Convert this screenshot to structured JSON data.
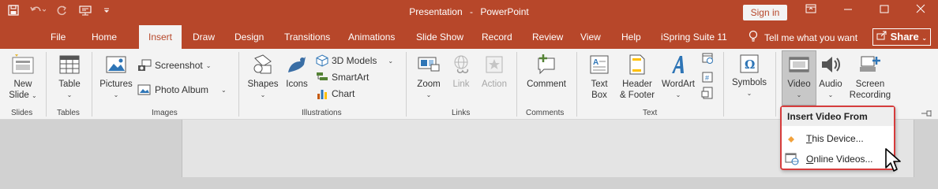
{
  "titlebar": {
    "doc_name": "Presentation",
    "separator": "-",
    "app_name": "PowerPoint",
    "sign_in": "Sign in"
  },
  "tabs": [
    {
      "label": "File"
    },
    {
      "label": "Home"
    },
    {
      "label": "Insert",
      "active": true
    },
    {
      "label": "Draw"
    },
    {
      "label": "Design"
    },
    {
      "label": "Transitions"
    },
    {
      "label": "Animations"
    },
    {
      "label": "Slide Show"
    },
    {
      "label": "Record"
    },
    {
      "label": "Review"
    },
    {
      "label": "View"
    },
    {
      "label": "Help"
    },
    {
      "label": "iSpring Suite 11"
    }
  ],
  "tell_me": "Tell me what you want",
  "share": "Share",
  "ribbon": {
    "new_slide": {
      "line1": "New",
      "line2": "Slide"
    },
    "table": "Table",
    "pictures": "Pictures",
    "screenshot": "Screenshot",
    "photo_album": "Photo Album",
    "shapes": "Shapes",
    "icons": "Icons",
    "models_3d": "3D Models",
    "smartart": "SmartArt",
    "chart": "Chart",
    "zoom": "Zoom",
    "link": "Link",
    "action": "Action",
    "comment": "Comment",
    "text_box": {
      "line1": "Text",
      "line2": "Box"
    },
    "header_footer": {
      "line1": "Header",
      "line2": "& Footer"
    },
    "wordart": "WordArt",
    "symbols": "Symbols",
    "video": "Video",
    "audio": "Audio",
    "screen_recording": {
      "line1": "Screen",
      "line2": "Recording"
    },
    "groups": {
      "slides": "Slides",
      "tables": "Tables",
      "images": "Images",
      "illustrations": "Illustrations",
      "links": "Links",
      "comments": "Comments",
      "text": "Text"
    }
  },
  "video_menu": {
    "header": "Insert Video From",
    "items": [
      {
        "accel": "T",
        "rest": "his Device..."
      },
      {
        "accel": "O",
        "rest": "nline Videos..."
      }
    ]
  },
  "colors": {
    "accent": "#b7472a",
    "menu_border": "#d63c3c"
  }
}
